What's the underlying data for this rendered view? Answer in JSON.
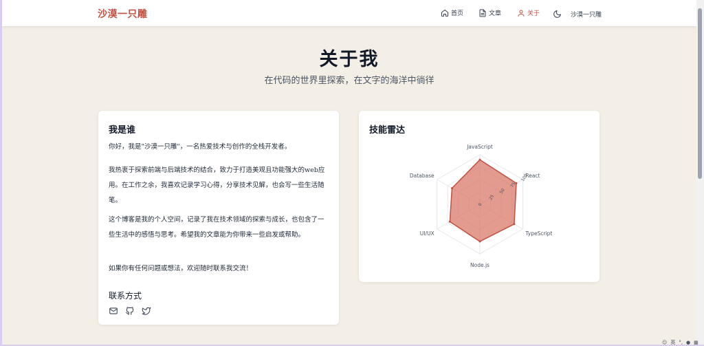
{
  "nav": {
    "brand": "沙漠一只雕",
    "items": [
      {
        "label": "首页",
        "icon": "home-icon"
      },
      {
        "label": "文章",
        "icon": "document-icon"
      },
      {
        "label": "关于",
        "icon": "user-icon",
        "active": true
      }
    ],
    "theme_icon": "moon-icon",
    "user": "沙漠一只雕"
  },
  "header": {
    "title": "关于我",
    "subtitle": "在代码的世界里探索，在文字的海洋中徜徉"
  },
  "about": {
    "title": "我是谁",
    "paragraphs": [
      "你好，我是\"沙漠一只雕\"，一名热爱技术与创作的全栈开发者。",
      "我热衷于探索前端与后端技术的结合，致力于打造美观且功能强大的web应用。在工作之余，我喜欢记录学习心得，分享技术见解，也会写一些生活随笔。",
      "这个博客是我的个人空间，记录了我在技术领域的探索与成长，也包含了一些生活中的感悟与思考。希望我的文章能为你带来一些启发或帮助。",
      "如果你有任何问题或想法，欢迎随时联系我交流！"
    ],
    "contact_title": "联系方式",
    "contact_icons": [
      "mail-icon",
      "github-icon",
      "twitter-icon"
    ]
  },
  "skills": {
    "title": "技能雷达",
    "chart_data": {
      "type": "radar",
      "axes": [
        "JavaScript",
        "React",
        "TypeScript",
        "Node.js",
        "UI/UX",
        "Database"
      ],
      "values": [
        90,
        85,
        80,
        75,
        70,
        65
      ],
      "range": [
        0,
        100
      ],
      "ticks": [
        "0",
        "25",
        "50",
        "75",
        "100"
      ],
      "fill_color": "#d9786a",
      "stroke_color": "#c0503f"
    }
  },
  "colors": {
    "accent": "#c0503f",
    "background": "#f3efe6",
    "card": "#ffffff"
  }
}
